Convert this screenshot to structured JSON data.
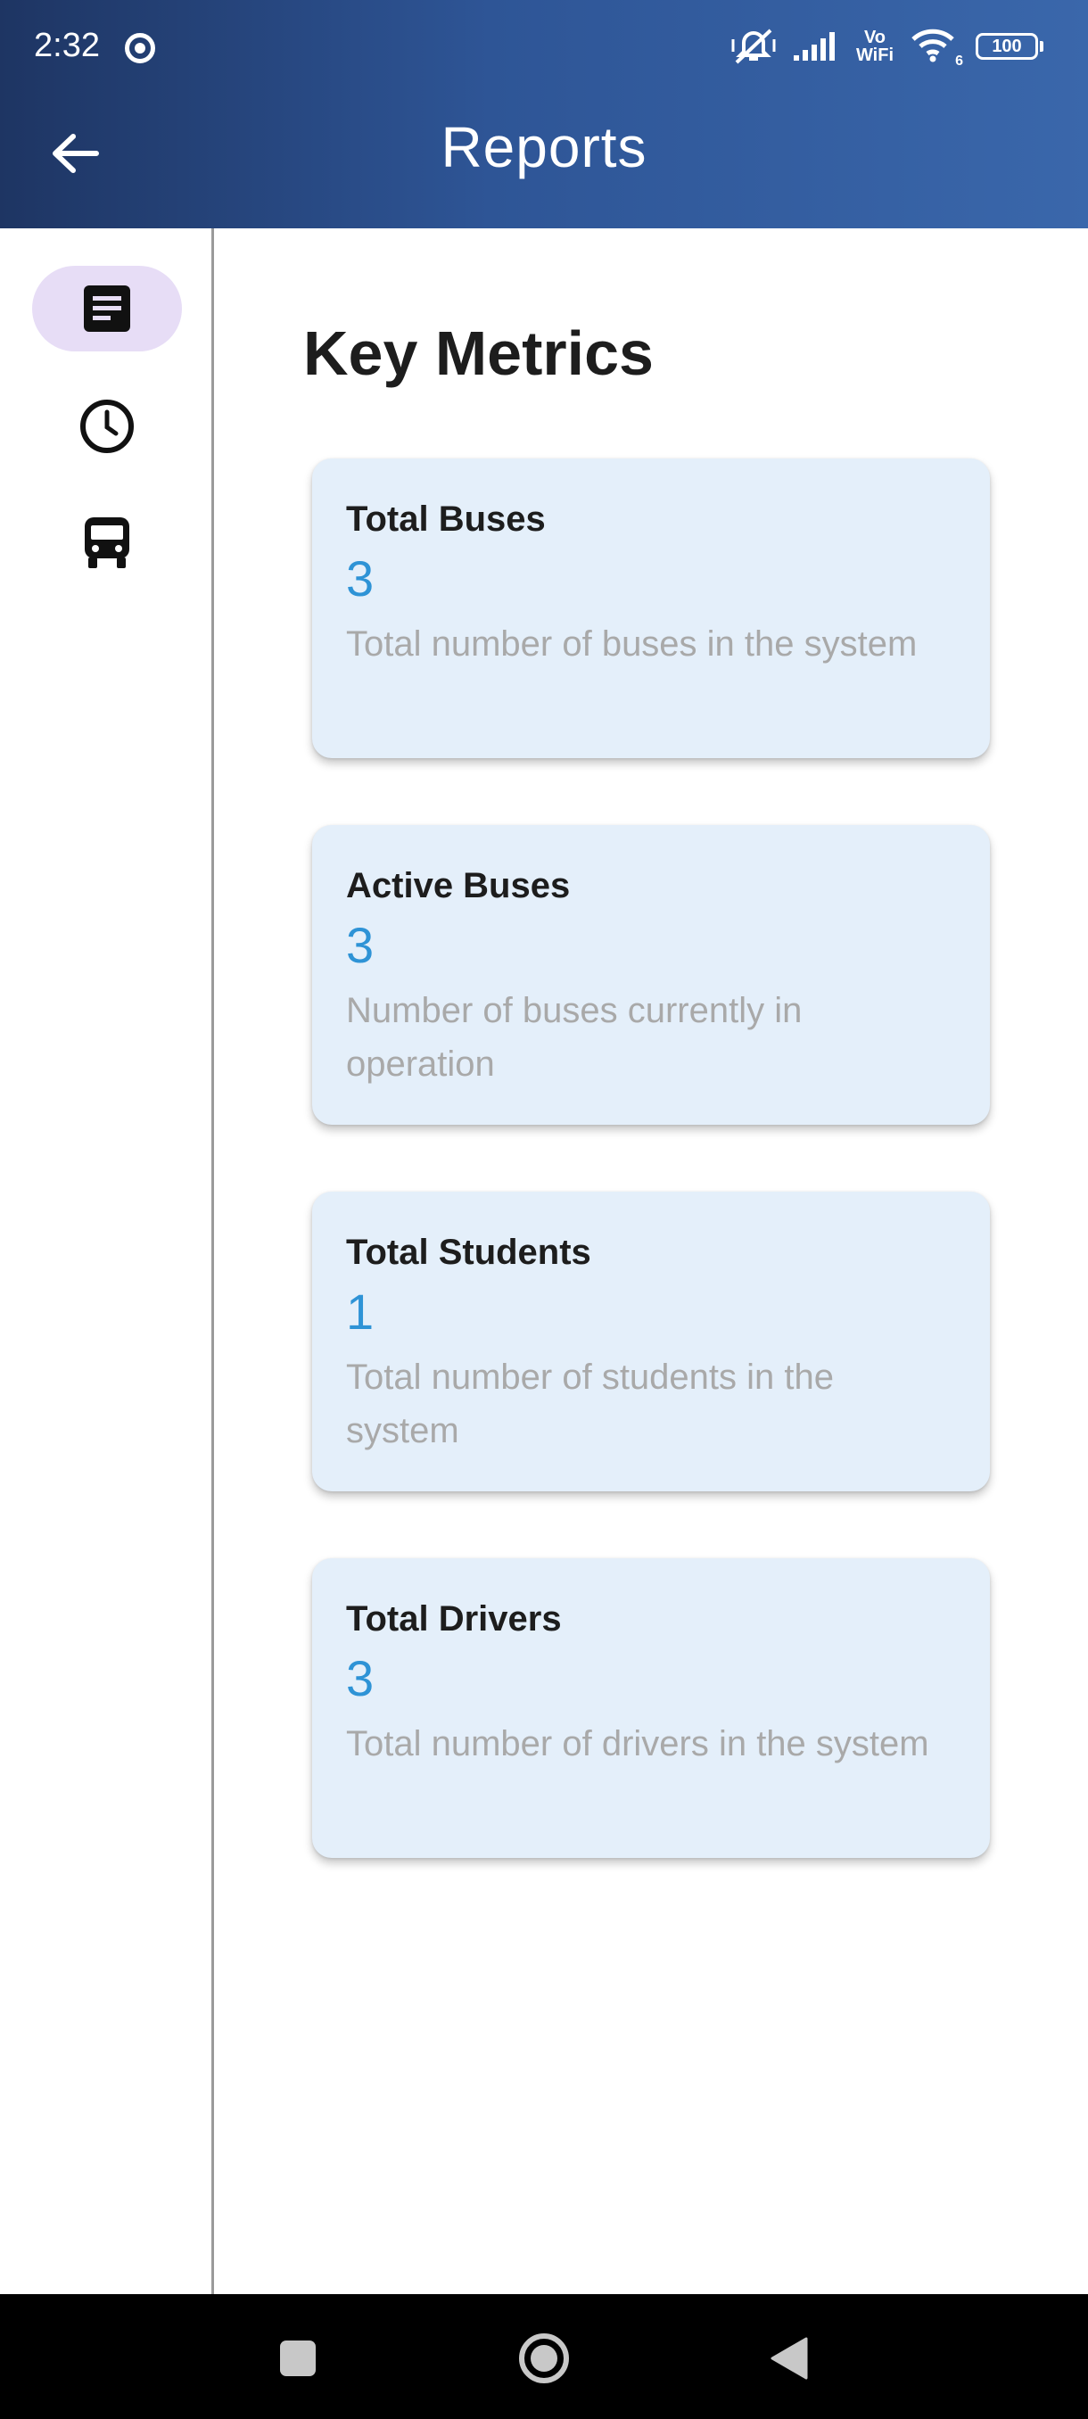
{
  "status_bar": {
    "time": "2:32",
    "vowifi_top": "Vo",
    "vowifi_bottom": "WiFi",
    "wifi_badge": "6",
    "battery": "100"
  },
  "app_bar": {
    "title": "Reports",
    "back_icon": "arrow-left-icon"
  },
  "rail": {
    "items": [
      {
        "icon": "report-document-icon",
        "active": true
      },
      {
        "icon": "clock-icon",
        "active": false
      },
      {
        "icon": "bus-icon",
        "active": false
      }
    ]
  },
  "main": {
    "section_title": "Key Metrics",
    "cards": [
      {
        "title": "Total Buses",
        "value": "3",
        "description": "Total number of buses in the system"
      },
      {
        "title": "Active Buses",
        "value": "3",
        "description": "Number of buses currently in operation"
      },
      {
        "title": "Total Students",
        "value": "1",
        "description": "Total number of students in the system"
      },
      {
        "title": "Total Drivers",
        "value": "3",
        "description": "Total number of drivers in the system"
      }
    ]
  },
  "colors": {
    "app_bar_start": "#1e3563",
    "app_bar_end": "#3a67ab",
    "card_bg": "#e4effa",
    "value_blue": "#2e93d6",
    "rail_active": "#e7ddf6"
  }
}
